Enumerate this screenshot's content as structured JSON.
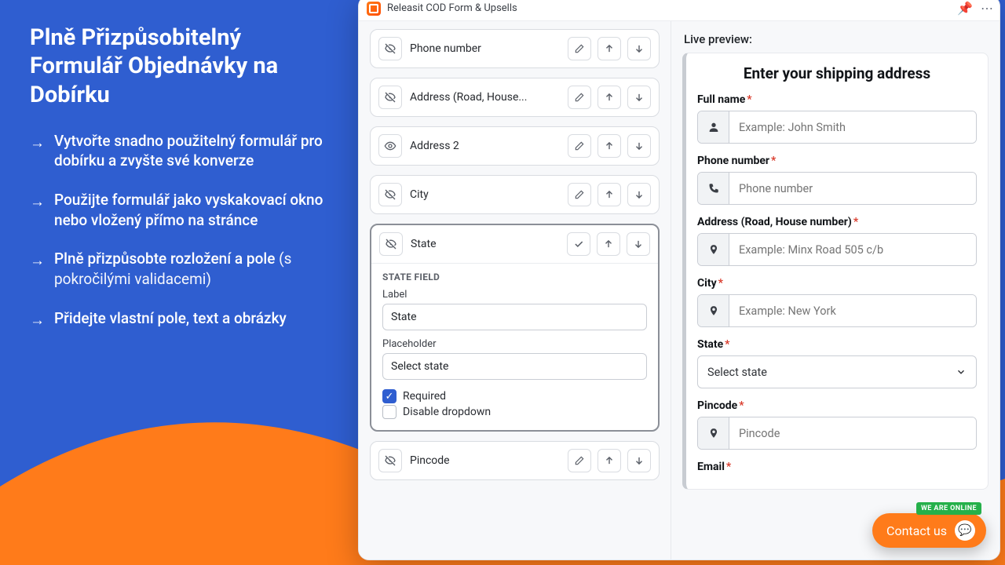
{
  "marketing": {
    "headline": "Plně Přizpůsobitelný Formulář Objednávky na Dobírku",
    "bullets": [
      {
        "text": "Vytvořte snadno použitelný formulář pro dobírku a zvyšte své konverze"
      },
      {
        "text": "Použijte formulář jako vyskakovací okno nebo vložený přímo na stránce"
      },
      {
        "text": "Plně přizpůsobte rozložení a pole",
        "sub": " (s pokročilými validacemi)"
      },
      {
        "text": "Přidejte vlastní pole, text a obrázky"
      }
    ]
  },
  "titlebar": {
    "app_name": "Releasit COD Form & Upsells"
  },
  "builder": {
    "fields": [
      {
        "label": "Phone number",
        "visible": false
      },
      {
        "label": "Address (Road, House...",
        "visible": false
      },
      {
        "label": "Address 2",
        "visible": true
      },
      {
        "label": "City",
        "visible": false
      },
      {
        "label": "State",
        "visible": false,
        "open": true
      },
      {
        "label": "Pincode",
        "visible": false
      }
    ],
    "expanded": {
      "section": "STATE FIELD",
      "label_caption": "Label",
      "label_value": "State",
      "placeholder_caption": "Placeholder",
      "placeholder_value": "Select state",
      "required_label": "Required",
      "required_checked": true,
      "disable_label": "Disable dropdown",
      "disable_checked": false
    }
  },
  "preview": {
    "title": "Live preview:",
    "heading": "Enter your shipping address",
    "fields": {
      "fullname": {
        "label": "Full name",
        "placeholder": "Example: John Smith"
      },
      "phone": {
        "label": "Phone number",
        "placeholder": "Phone number"
      },
      "address": {
        "label": "Address (Road, House number)",
        "placeholder": "Example: Minx Road 505 c/b"
      },
      "city": {
        "label": "City",
        "placeholder": "Example: New York"
      },
      "state": {
        "label": "State",
        "placeholder": "Select state"
      },
      "pincode": {
        "label": "Pincode",
        "placeholder": "Pincode"
      },
      "email": {
        "label": "Email"
      }
    }
  },
  "chat": {
    "label": "Contact us",
    "badge": "WE ARE ONLINE"
  }
}
